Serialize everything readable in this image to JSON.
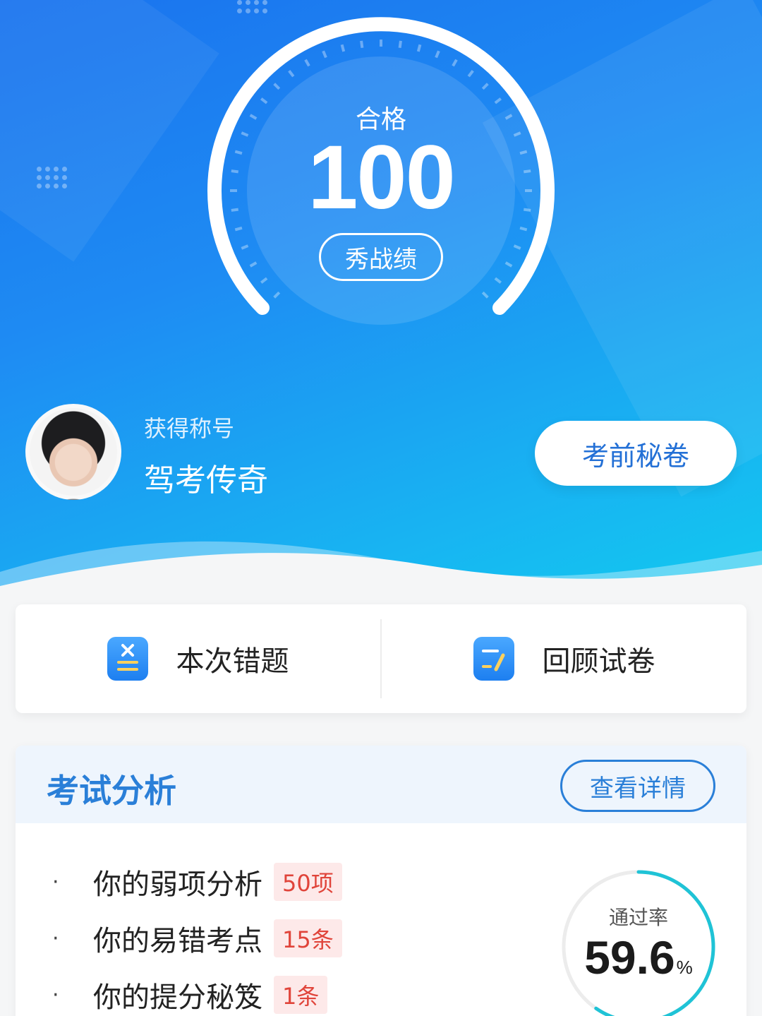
{
  "score": {
    "status_label": "合格",
    "value": "100",
    "share_button": "秀战绩"
  },
  "profile": {
    "title_caption": "获得称号",
    "title_name": "驾考传奇",
    "secret_button": "考前秘卷"
  },
  "actions": {
    "wrong_label": "本次错题",
    "review_label": "回顾试卷"
  },
  "analysis": {
    "title": "考试分析",
    "detail_button": "查看详情",
    "items": [
      {
        "bullet": "·",
        "text": "你的弱项分析",
        "tag": "50项"
      },
      {
        "bullet": "·",
        "text": "你的易错考点",
        "tag": "15条"
      },
      {
        "bullet": "·",
        "text": "你的提分秘笈",
        "tag": "1条"
      }
    ],
    "pass_rate": {
      "label": "通过率",
      "value": "59.6",
      "unit": "%",
      "ratio": 0.596
    }
  },
  "colors": {
    "accent": "#2a7fd8",
    "tag_red": "#e0443a",
    "ring": "#1fc3d6"
  }
}
